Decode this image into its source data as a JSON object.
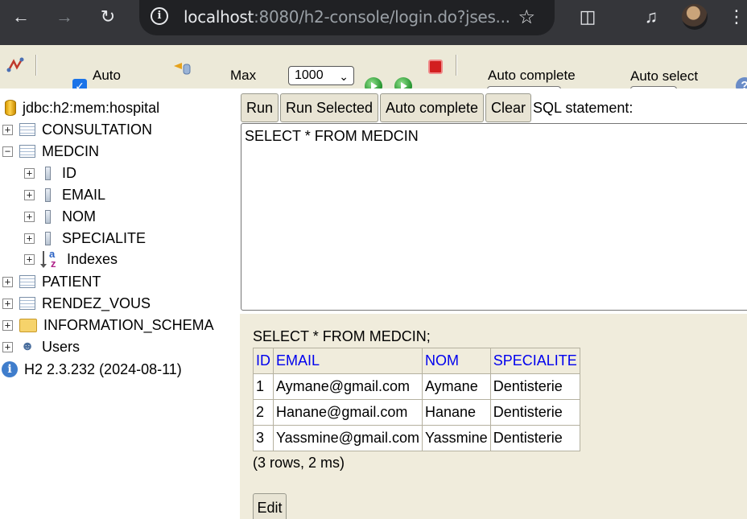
{
  "browser": {
    "url_host": "localhost",
    "url_rest": ":8080/h2-console/login.do?jses..."
  },
  "toolbar": {
    "auto_commit_label": "Auto",
    "max_rows_label": "Max",
    "max_rows_value": "1000",
    "auto_complete_label": "Auto complete",
    "auto_select_label": "Auto select"
  },
  "tree": {
    "connection": "jdbc:h2:mem:hospital",
    "items": [
      {
        "label": "CONSULTATION"
      },
      {
        "label": "MEDCIN"
      },
      {
        "label": "ID"
      },
      {
        "label": "EMAIL"
      },
      {
        "label": "NOM"
      },
      {
        "label": "SPECIALITE"
      },
      {
        "label": "Indexes"
      },
      {
        "label": "PATIENT"
      },
      {
        "label": "RENDEZ_VOUS"
      },
      {
        "label": "INFORMATION_SCHEMA"
      },
      {
        "label": "Users"
      }
    ],
    "version": "H2 2.3.232 (2024-08-11)"
  },
  "query": {
    "run_label": "Run",
    "run_selected_label": "Run Selected",
    "auto_complete_label": "Auto complete",
    "clear_label": "Clear",
    "sql_statement_label": "SQL statement:",
    "sql_text": "SELECT * FROM MEDCIN"
  },
  "result": {
    "statement": "SELECT * FROM MEDCIN;",
    "columns": [
      "ID",
      "EMAIL",
      "NOM",
      "SPECIALITE"
    ],
    "rows": [
      [
        "1",
        "Aymane@gmail.com",
        "Aymane",
        "Dentisterie"
      ],
      [
        "2",
        "Hanane@gmail.com",
        "Hanane",
        "Dentisterie"
      ],
      [
        "3",
        "Yassmine@gmail.com",
        "Yassmine",
        "Dentisterie"
      ]
    ],
    "row_count": "(3 rows, 2 ms)",
    "edit_label": "Edit"
  }
}
